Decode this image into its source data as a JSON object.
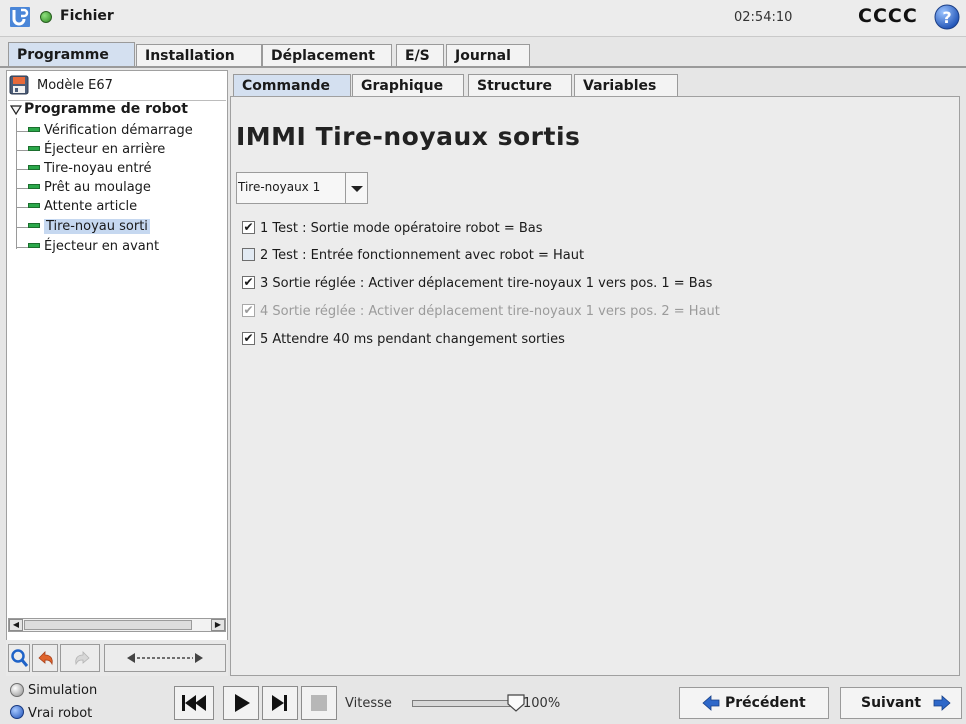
{
  "topbar": {
    "file_label": "Fichier",
    "clock": "02:54:10",
    "robot_name": "CCCC"
  },
  "main_tabs": [
    {
      "label": "Programme",
      "active": true
    },
    {
      "label": "Installation",
      "active": false
    },
    {
      "label": "Déplacement",
      "active": false
    },
    {
      "label": "E/S",
      "active": false
    },
    {
      "label": "Journal",
      "active": false
    }
  ],
  "left_panel": {
    "model_name": "Modèle E67",
    "tree_root": "Programme de robot",
    "tree_items": [
      {
        "label": "Vérification démarrage",
        "selected": false
      },
      {
        "label": "Éjecteur en arrière",
        "selected": false
      },
      {
        "label": "Tire-noyau entré",
        "selected": false
      },
      {
        "label": "Prêt au moulage",
        "selected": false
      },
      {
        "label": "Attente article",
        "selected": false
      },
      {
        "label": "Tire-noyau sorti",
        "selected": true
      },
      {
        "label": "Éjecteur en avant",
        "selected": false
      }
    ]
  },
  "sub_tabs": [
    {
      "label": "Commande",
      "active": true
    },
    {
      "label": "Graphique",
      "active": false
    },
    {
      "label": "Structure",
      "active": false
    },
    {
      "label": "Variables",
      "active": false
    }
  ],
  "command": {
    "title": "IMMI Tire-noyaux sortis",
    "selector_value": "Tire-noyaux 1",
    "items": [
      {
        "label": "1 Test : Sortie mode opératoire robot = Bas",
        "checked": true,
        "enabled": true
      },
      {
        "label": "2 Test : Entrée fonctionnement avec robot = Haut",
        "checked": false,
        "enabled": true
      },
      {
        "label": "3 Sortie réglée : Activer déplacement tire-noyaux 1 vers pos. 1 = Bas",
        "checked": true,
        "enabled": true
      },
      {
        "label": "4 Sortie réglée : Activer déplacement tire-noyaux 1 vers pos. 2 = Haut",
        "checked": true,
        "enabled": false
      },
      {
        "label": "5 Attendre 40 ms pendant changement sorties",
        "checked": true,
        "enabled": true
      }
    ]
  },
  "bottom": {
    "simulation_label": "Simulation",
    "real_robot_label": "Vrai robot",
    "speed_label": "Vitesse",
    "speed_value": "100%",
    "prev_label": "Précédent",
    "next_label": "Suivant"
  },
  "colors": {
    "accent": "#d4e0f0",
    "selection": "#c6d8f0",
    "node_green": "#2ba84a"
  }
}
